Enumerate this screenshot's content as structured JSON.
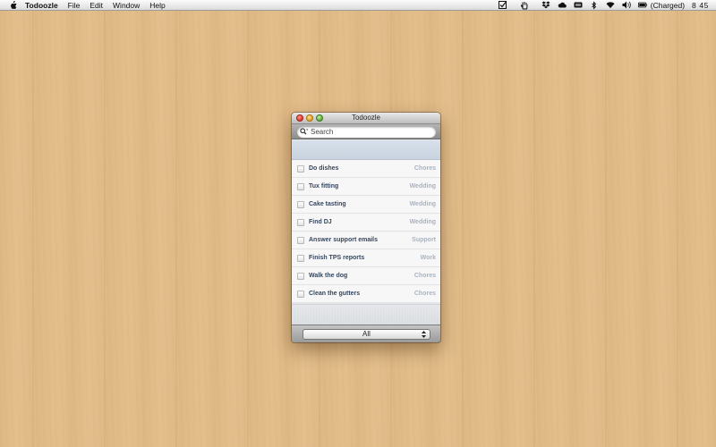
{
  "menubar": {
    "app_name": "Todoozle",
    "menus": [
      "File",
      "Edit",
      "Window",
      "Help"
    ],
    "battery_status": "(Charged)",
    "clock": "8 45"
  },
  "window": {
    "title": "Todoozle",
    "search": {
      "placeholder": "Search",
      "value": ""
    },
    "tasks": [
      {
        "title": "Do dishes",
        "tag": "Chores",
        "done": false
      },
      {
        "title": "Tux fitting",
        "tag": "Wedding",
        "done": false
      },
      {
        "title": "Cake tasting",
        "tag": "Wedding",
        "done": false
      },
      {
        "title": "Find DJ",
        "tag": "Wedding",
        "done": false
      },
      {
        "title": "Answer support emails",
        "tag": "Support",
        "done": false
      },
      {
        "title": "Finish TPS reports",
        "tag": "Work",
        "done": false
      },
      {
        "title": "Walk the dog",
        "tag": "Chores",
        "done": false
      },
      {
        "title": "Clean the gutters",
        "tag": "Chores",
        "done": false
      }
    ],
    "filter": {
      "selected": "All"
    }
  },
  "colors": {
    "desktop": "#e2bd8a",
    "task_title": "#36475e",
    "task_tag": "#a9b3bf"
  }
}
